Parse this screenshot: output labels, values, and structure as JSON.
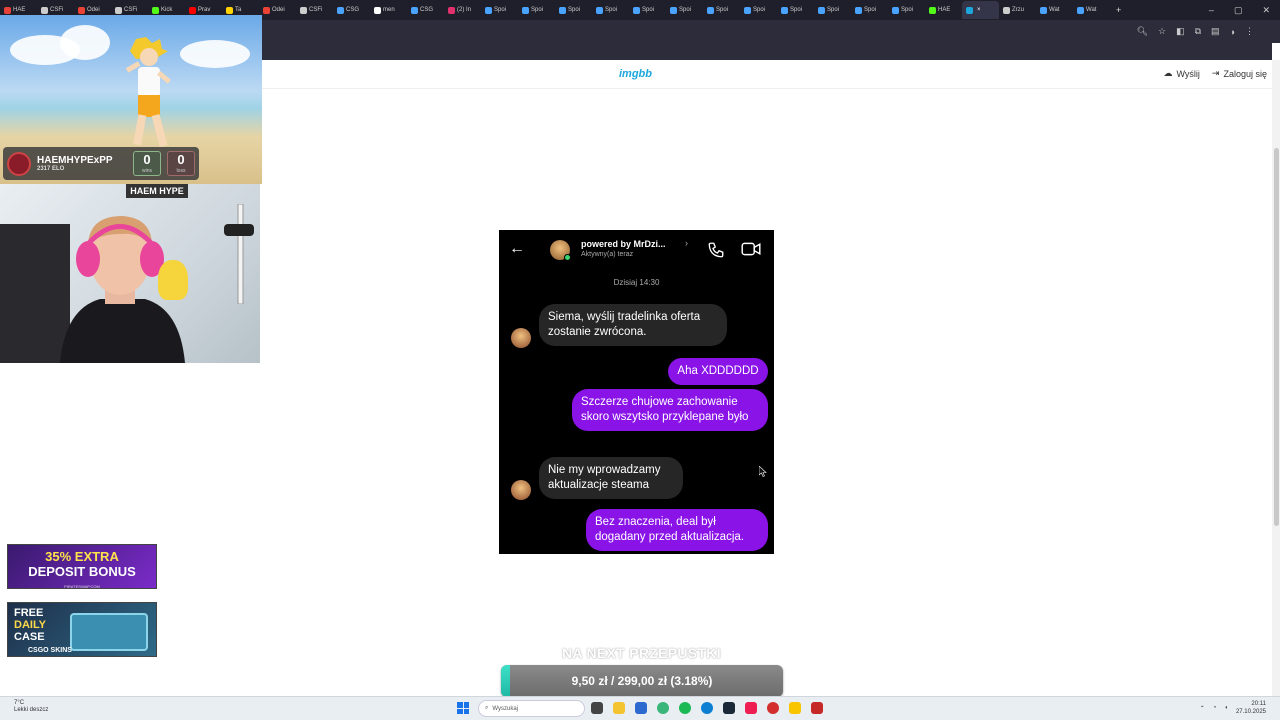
{
  "browser": {
    "tabs": [
      {
        "label": "HAE",
        "color": "#e6423a"
      },
      {
        "label": "CSFi",
        "color": "#cccccc"
      },
      {
        "label": "Odei",
        "color": "#ea4335"
      },
      {
        "label": "CSFi",
        "color": "#cccccc"
      },
      {
        "label": "Kick",
        "color": "#53fc18"
      },
      {
        "label": "Prav",
        "color": "#ff0000"
      },
      {
        "label": "Ta",
        "color": "#ffd400"
      },
      {
        "label": "Odei",
        "color": "#ea4335"
      },
      {
        "label": "CSFi",
        "color": "#cccccc"
      },
      {
        "label": "CSG",
        "color": "#4aa3ff"
      },
      {
        "label": "men",
        "color": "#ffffff"
      },
      {
        "label": "CSG",
        "color": "#4aa3ff"
      },
      {
        "label": "(2) In",
        "color": "#e1306c"
      },
      {
        "label": "Spoi",
        "color": "#4aa3ff"
      },
      {
        "label": "Spoi",
        "color": "#4aa3ff"
      },
      {
        "label": "Spoi",
        "color": "#4aa3ff"
      },
      {
        "label": "Spoi",
        "color": "#4aa3ff"
      },
      {
        "label": "Spoi",
        "color": "#4aa3ff"
      },
      {
        "label": "Spoi",
        "color": "#4aa3ff"
      },
      {
        "label": "Spoi",
        "color": "#4aa3ff"
      },
      {
        "label": "Spoi",
        "color": "#4aa3ff"
      },
      {
        "label": "Spoi",
        "color": "#4aa3ff"
      },
      {
        "label": "Spoi",
        "color": "#4aa3ff"
      },
      {
        "label": "Spoi",
        "color": "#4aa3ff"
      },
      {
        "label": "Spoi",
        "color": "#4aa3ff"
      },
      {
        "label": "HAE",
        "color": "#53fc18"
      },
      {
        "label": "",
        "color": "#1ca7dd",
        "active": true
      },
      {
        "label": "Zrzu",
        "color": "#cccccc"
      },
      {
        "label": "Wat",
        "color": "#4aa3ff"
      },
      {
        "label": "Wat",
        "color": "#4aa3ff"
      }
    ],
    "new_tab": "+",
    "close_tab": "×",
    "window_controls": {
      "minimize": "–",
      "maximize": "▢",
      "close": "✕"
    }
  },
  "site": {
    "logo": "imgbb",
    "upload_label": "Wyślij",
    "login_label": "Zaloguj się"
  },
  "stream_overlay": {
    "player_name": "HAEMHYPExPP",
    "elo": "2317 ELO",
    "wins": "0",
    "wins_label": "wins",
    "losses": "0",
    "losses_label": "loss",
    "cam_logo": "HAEM HYPE",
    "ad1": {
      "line1": "35% EXTRA",
      "line2": "DEPOSIT BONUS",
      "footer": "PIRATESWAP.COM"
    },
    "ad2": {
      "line1": "FREE",
      "line2": "DAILY",
      "line3": "CASE",
      "footer": "CSGO SKINS"
    }
  },
  "chat": {
    "contact_name": "powered by MrDzi...",
    "contact_status": "Aktywny(a) teraz",
    "date": "Dzisiaj 14:30",
    "messages": [
      {
        "side": "in",
        "text": "Siema, wyślij tradelinka oferta zostanie zwrócona."
      },
      {
        "side": "out",
        "text": "Aha XDDDDDD"
      },
      {
        "side": "out",
        "text": "Szczerze chujowe zachowanie skoro wszytsko przyklepane było"
      },
      {
        "side": "in",
        "text": "Nie my wprowadzamy aktualizacje steama"
      },
      {
        "side": "out",
        "text": "Bez znaczenia, deal był dogadany przed aktualizacja."
      }
    ]
  },
  "goal": {
    "label": "NA NEXT PRZEPUSTKI",
    "text": "9,50 zł / 299,00 zł (3.18%)",
    "progress_fraction": 0.0318
  },
  "taskbar": {
    "weather_temp": "7°C",
    "weather_desc": "Lekki deszcz",
    "search_placeholder": "Wyszukaj",
    "time": "20:11",
    "date": "27.10.2025"
  }
}
